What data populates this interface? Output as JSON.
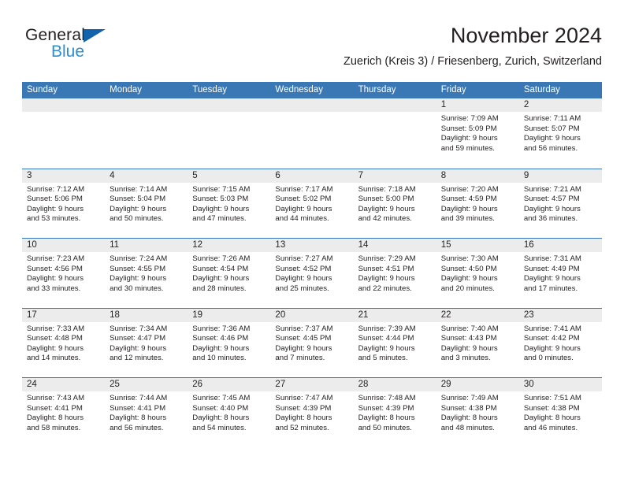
{
  "brand": {
    "word1": "General",
    "word2": "Blue",
    "triangle_color": "#1263ac",
    "word2_color": "#2a8fd4"
  },
  "header": {
    "month_title": "November 2024",
    "location": "Zuerich (Kreis 3) / Friesenberg, Zurich, Switzerland"
  },
  "theme": {
    "header_blue": "#3a78b5",
    "daynum_band": "#ececec",
    "text": "#231f20"
  },
  "calendar": {
    "weekday_headers": [
      "Sunday",
      "Monday",
      "Tuesday",
      "Wednesday",
      "Thursday",
      "Friday",
      "Saturday"
    ],
    "weeks": [
      [
        {
          "day": "",
          "lines": []
        },
        {
          "day": "",
          "lines": []
        },
        {
          "day": "",
          "lines": []
        },
        {
          "day": "",
          "lines": []
        },
        {
          "day": "",
          "lines": []
        },
        {
          "day": "1",
          "lines": [
            "Sunrise: 7:09 AM",
            "Sunset: 5:09 PM",
            "Daylight: 9 hours",
            "and 59 minutes."
          ]
        },
        {
          "day": "2",
          "lines": [
            "Sunrise: 7:11 AM",
            "Sunset: 5:07 PM",
            "Daylight: 9 hours",
            "and 56 minutes."
          ]
        }
      ],
      [
        {
          "day": "3",
          "lines": [
            "Sunrise: 7:12 AM",
            "Sunset: 5:06 PM",
            "Daylight: 9 hours",
            "and 53 minutes."
          ]
        },
        {
          "day": "4",
          "lines": [
            "Sunrise: 7:14 AM",
            "Sunset: 5:04 PM",
            "Daylight: 9 hours",
            "and 50 minutes."
          ]
        },
        {
          "day": "5",
          "lines": [
            "Sunrise: 7:15 AM",
            "Sunset: 5:03 PM",
            "Daylight: 9 hours",
            "and 47 minutes."
          ]
        },
        {
          "day": "6",
          "lines": [
            "Sunrise: 7:17 AM",
            "Sunset: 5:02 PM",
            "Daylight: 9 hours",
            "and 44 minutes."
          ]
        },
        {
          "day": "7",
          "lines": [
            "Sunrise: 7:18 AM",
            "Sunset: 5:00 PM",
            "Daylight: 9 hours",
            "and 42 minutes."
          ]
        },
        {
          "day": "8",
          "lines": [
            "Sunrise: 7:20 AM",
            "Sunset: 4:59 PM",
            "Daylight: 9 hours",
            "and 39 minutes."
          ]
        },
        {
          "day": "9",
          "lines": [
            "Sunrise: 7:21 AM",
            "Sunset: 4:57 PM",
            "Daylight: 9 hours",
            "and 36 minutes."
          ]
        }
      ],
      [
        {
          "day": "10",
          "lines": [
            "Sunrise: 7:23 AM",
            "Sunset: 4:56 PM",
            "Daylight: 9 hours",
            "and 33 minutes."
          ]
        },
        {
          "day": "11",
          "lines": [
            "Sunrise: 7:24 AM",
            "Sunset: 4:55 PM",
            "Daylight: 9 hours",
            "and 30 minutes."
          ]
        },
        {
          "day": "12",
          "lines": [
            "Sunrise: 7:26 AM",
            "Sunset: 4:54 PM",
            "Daylight: 9 hours",
            "and 28 minutes."
          ]
        },
        {
          "day": "13",
          "lines": [
            "Sunrise: 7:27 AM",
            "Sunset: 4:52 PM",
            "Daylight: 9 hours",
            "and 25 minutes."
          ]
        },
        {
          "day": "14",
          "lines": [
            "Sunrise: 7:29 AM",
            "Sunset: 4:51 PM",
            "Daylight: 9 hours",
            "and 22 minutes."
          ]
        },
        {
          "day": "15",
          "lines": [
            "Sunrise: 7:30 AM",
            "Sunset: 4:50 PM",
            "Daylight: 9 hours",
            "and 20 minutes."
          ]
        },
        {
          "day": "16",
          "lines": [
            "Sunrise: 7:31 AM",
            "Sunset: 4:49 PM",
            "Daylight: 9 hours",
            "and 17 minutes."
          ]
        }
      ],
      [
        {
          "day": "17",
          "lines": [
            "Sunrise: 7:33 AM",
            "Sunset: 4:48 PM",
            "Daylight: 9 hours",
            "and 14 minutes."
          ]
        },
        {
          "day": "18",
          "lines": [
            "Sunrise: 7:34 AM",
            "Sunset: 4:47 PM",
            "Daylight: 9 hours",
            "and 12 minutes."
          ]
        },
        {
          "day": "19",
          "lines": [
            "Sunrise: 7:36 AM",
            "Sunset: 4:46 PM",
            "Daylight: 9 hours",
            "and 10 minutes."
          ]
        },
        {
          "day": "20",
          "lines": [
            "Sunrise: 7:37 AM",
            "Sunset: 4:45 PM",
            "Daylight: 9 hours",
            "and 7 minutes."
          ]
        },
        {
          "day": "21",
          "lines": [
            "Sunrise: 7:39 AM",
            "Sunset: 4:44 PM",
            "Daylight: 9 hours",
            "and 5 minutes."
          ]
        },
        {
          "day": "22",
          "lines": [
            "Sunrise: 7:40 AM",
            "Sunset: 4:43 PM",
            "Daylight: 9 hours",
            "and 3 minutes."
          ]
        },
        {
          "day": "23",
          "lines": [
            "Sunrise: 7:41 AM",
            "Sunset: 4:42 PM",
            "Daylight: 9 hours",
            "and 0 minutes."
          ]
        }
      ],
      [
        {
          "day": "24",
          "lines": [
            "Sunrise: 7:43 AM",
            "Sunset: 4:41 PM",
            "Daylight: 8 hours",
            "and 58 minutes."
          ]
        },
        {
          "day": "25",
          "lines": [
            "Sunrise: 7:44 AM",
            "Sunset: 4:41 PM",
            "Daylight: 8 hours",
            "and 56 minutes."
          ]
        },
        {
          "day": "26",
          "lines": [
            "Sunrise: 7:45 AM",
            "Sunset: 4:40 PM",
            "Daylight: 8 hours",
            "and 54 minutes."
          ]
        },
        {
          "day": "27",
          "lines": [
            "Sunrise: 7:47 AM",
            "Sunset: 4:39 PM",
            "Daylight: 8 hours",
            "and 52 minutes."
          ]
        },
        {
          "day": "28",
          "lines": [
            "Sunrise: 7:48 AM",
            "Sunset: 4:39 PM",
            "Daylight: 8 hours",
            "and 50 minutes."
          ]
        },
        {
          "day": "29",
          "lines": [
            "Sunrise: 7:49 AM",
            "Sunset: 4:38 PM",
            "Daylight: 8 hours",
            "and 48 minutes."
          ]
        },
        {
          "day": "30",
          "lines": [
            "Sunrise: 7:51 AM",
            "Sunset: 4:38 PM",
            "Daylight: 8 hours",
            "and 46 minutes."
          ]
        }
      ]
    ]
  }
}
